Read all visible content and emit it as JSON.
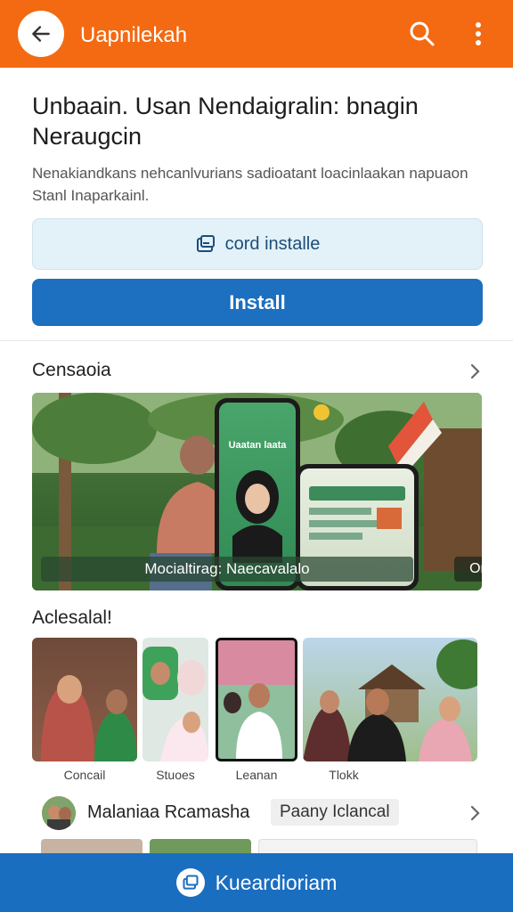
{
  "appbar": {
    "title": "Uapnilekah",
    "back_icon": "arrow-left-icon",
    "search_icon": "search-icon",
    "more_icon": "more-vertical-icon",
    "color": "#f36a12"
  },
  "hero": {
    "title": "Unbaain. Usan Nendaigralin: bnagin Neraugcin",
    "description": "Nenakiandkans nehcanlvurians sadioatant loacinlaakan napuaon Stanl Inaparkainl.",
    "secondary_button": "cord installe",
    "secondary_icon": "install-card-icon",
    "install_button": "Install",
    "accent": "#1d6fbf"
  },
  "featured": {
    "heading": "Censaoia",
    "phone_title": "Uaatan laata",
    "caption": "Mocialtirag: Naecavalalo",
    "chip": "Om"
  },
  "gallery": {
    "heading": "Aclesalal!",
    "items": [
      {
        "label": "Concail"
      },
      {
        "label": "Stuoes"
      },
      {
        "label": "Leanan"
      },
      {
        "label": "Tlokk"
      }
    ]
  },
  "list": {
    "name": "Malaniaa Rcamasha",
    "badge": "Paany Iclancal"
  },
  "bottom_bar": {
    "label": "Kueardioriam",
    "icon": "install-card-icon",
    "color": "#1a6ec0"
  }
}
